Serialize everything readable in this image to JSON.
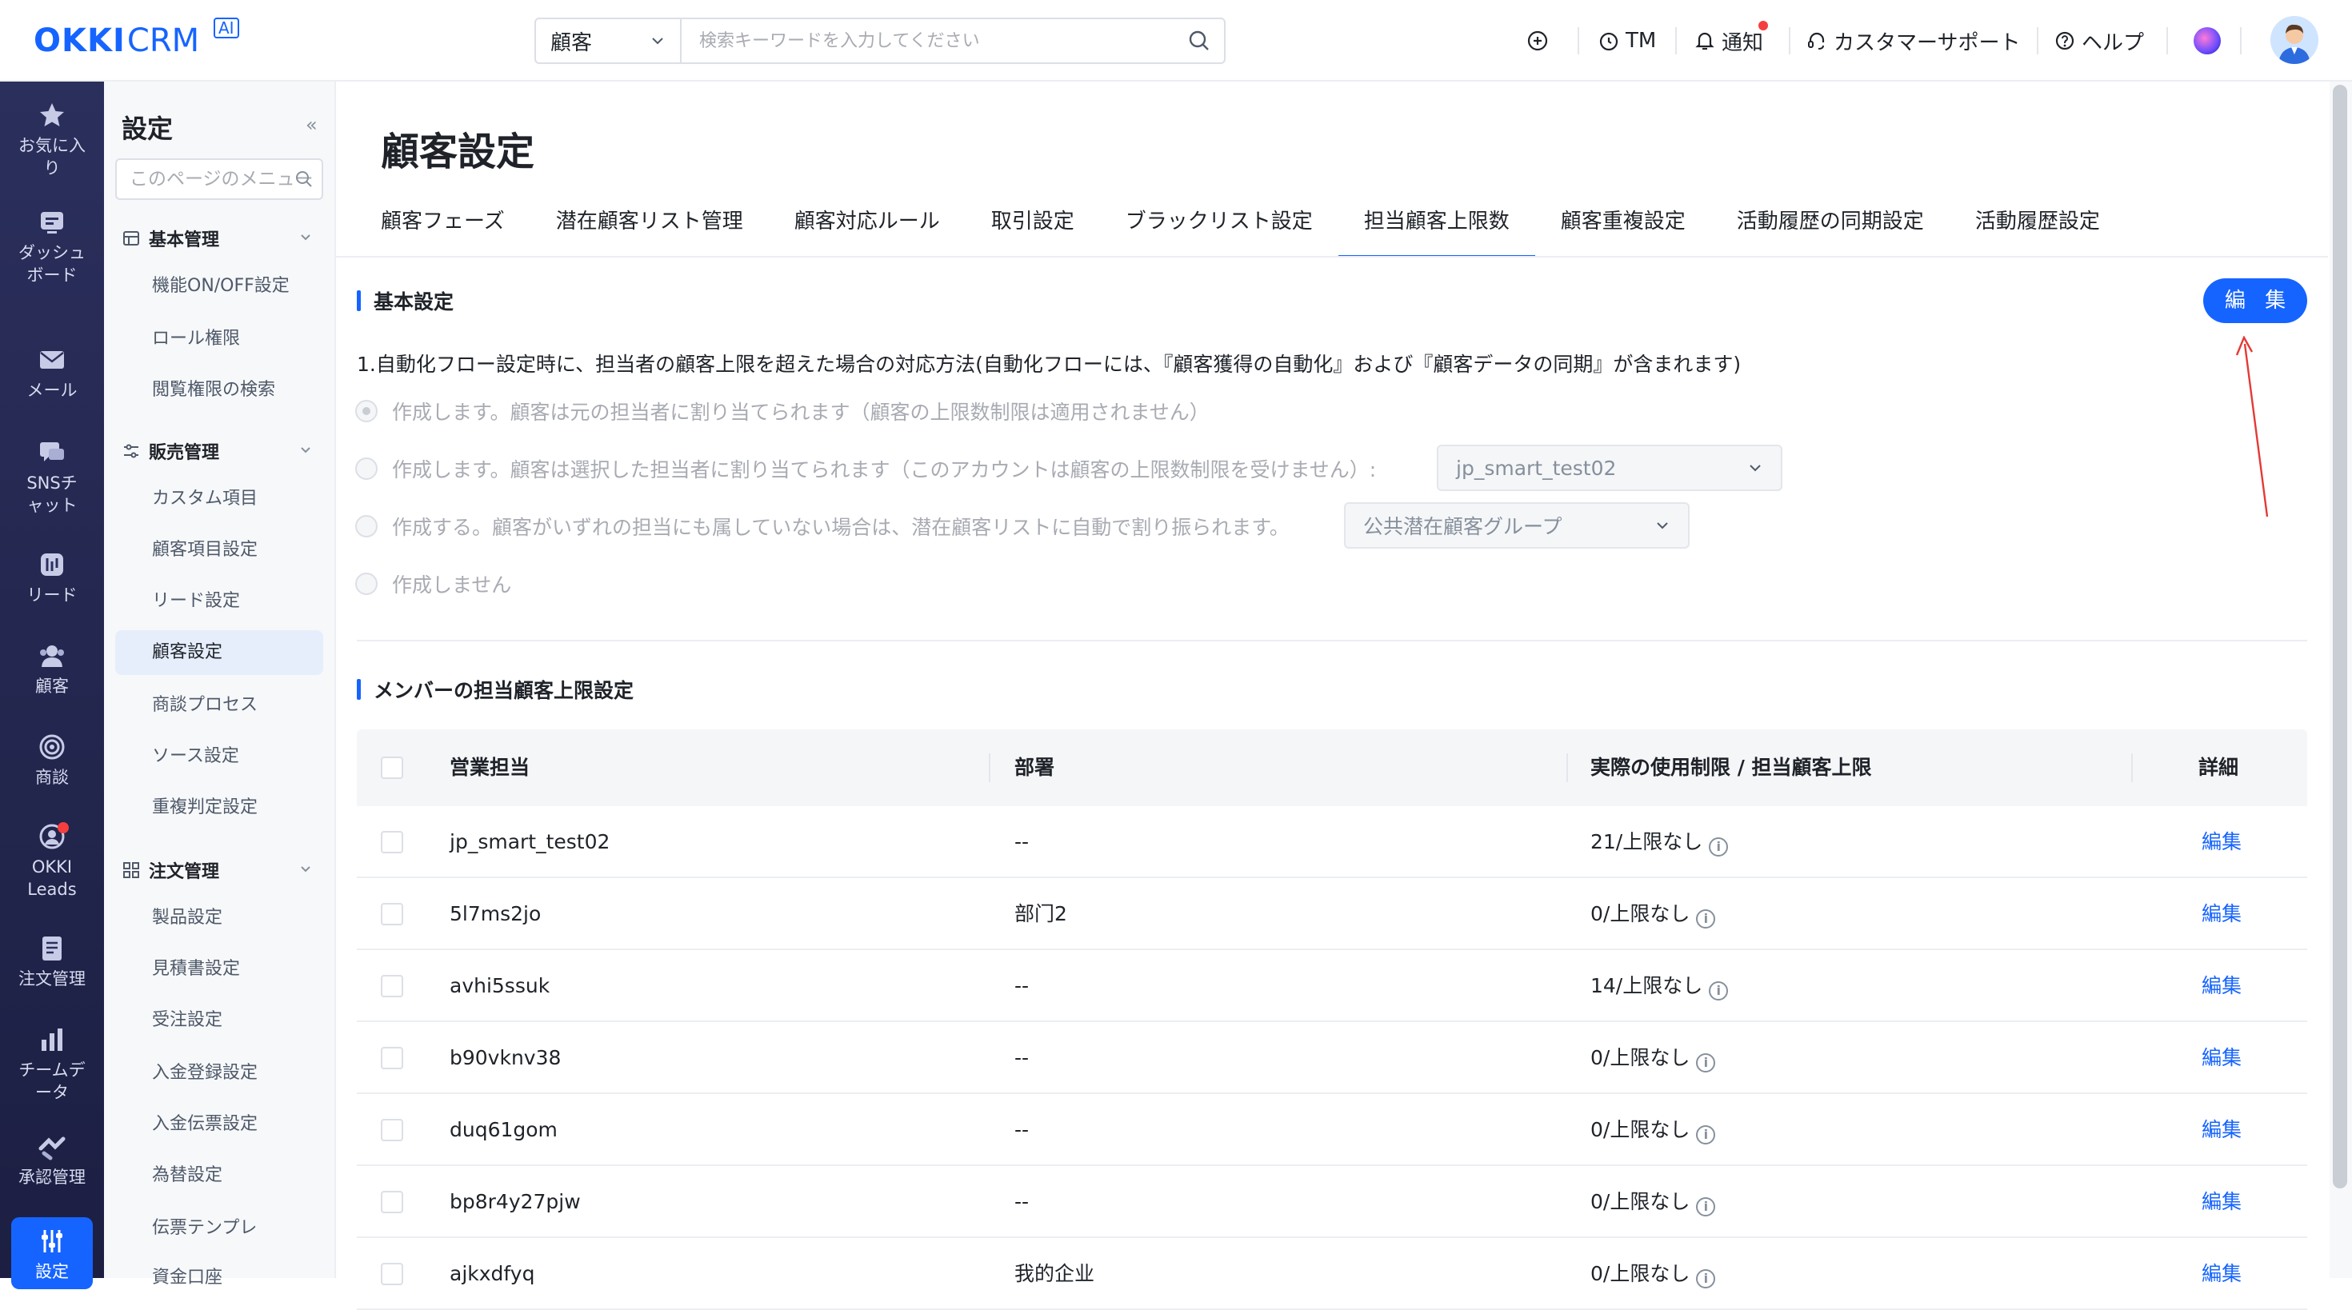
{
  "brand": {
    "logo_main": "OKKI",
    "logo_sub": "CRM",
    "logo_badge": "AI",
    "accent": "#1664ff"
  },
  "search": {
    "scope": "顧客",
    "placeholder": "検索キーワードを入力してください"
  },
  "topbar": {
    "tm": "TM",
    "notify": "通知",
    "support": "カスタマーサポート",
    "help": "ヘルプ"
  },
  "leftnav": [
    {
      "label": "お気に入り",
      "icon": "star-icon"
    },
    {
      "label": "ダッシュボード",
      "icon": "dashboard-icon"
    },
    {
      "label": "メール",
      "icon": "mail-icon"
    },
    {
      "label": "SNSチャット",
      "icon": "chat-icon"
    },
    {
      "label": "リード",
      "icon": "lead-icon"
    },
    {
      "label": "顧客",
      "icon": "customer-icon"
    },
    {
      "label": "商談",
      "icon": "target-icon"
    },
    {
      "label": "OKKI Leads",
      "icon": "okki-leads-icon"
    },
    {
      "label": "注文管理",
      "icon": "order-icon"
    },
    {
      "label": "チームデータ",
      "icon": "chart-icon"
    },
    {
      "label": "承認管理",
      "icon": "approval-icon"
    },
    {
      "label": "設定",
      "icon": "settings-icon"
    }
  ],
  "settings": {
    "title": "設定",
    "search_placeholder": "このページのメニュー",
    "groups": [
      {
        "label": "基本管理",
        "items": [
          "機能ON/OFF設定",
          "ロール権限",
          "閲覧権限の検索"
        ]
      },
      {
        "label": "販売管理",
        "items": [
          "カスタム項目",
          "顧客項目設定",
          "リード設定",
          "顧客設定",
          "商談プロセス",
          "ソース設定",
          "重複判定設定"
        ]
      },
      {
        "label": "注文管理",
        "items": [
          "製品設定",
          "見積書設定",
          "受注設定",
          "入金登録設定",
          "入金伝票設定",
          "為替設定",
          "伝票テンプレ",
          "資金口座"
        ]
      }
    ],
    "active_item": "顧客設定"
  },
  "page": {
    "title": "顧客設定",
    "tabs": [
      "顧客フェーズ",
      "潜在顧客リスト管理",
      "顧客対応ルール",
      "取引設定",
      "ブラックリスト設定",
      "担当顧客上限数",
      "顧客重複設定",
      "活動履歴の同期設定",
      "活動履歴設定"
    ],
    "active_tab": "担当顧客上限数",
    "edit_button": "編 集"
  },
  "basic": {
    "heading": "基本設定",
    "question": "1.自動化フロー設定時に、担当者の顧客上限を超えた場合の対応方法(自動化フローには、『顧客獲得の自動化』および『顧客データの同期』が含まれます)",
    "options": [
      "作成します。顧客は元の担当者に割り当てられます（顧客の上限数制限は適用されません）",
      "作成します。顧客は選択した担当者に割り当てられます（このアカウントは顧客の上限数制限を受けません）:",
      "作成する。顧客がいずれの担当にも属していない場合は、潜在顧客リストに自動で割り振られます。",
      "作成しません"
    ],
    "selected_option": 0,
    "owner_select": "jp_smart_test02",
    "pool_select": "公共潜在顧客グループ"
  },
  "members": {
    "heading": "メンバーの担当顧客上限設定",
    "columns": [
      "営業担当",
      "部署",
      "実際の使用制限 / 担当顧客上限",
      "詳細"
    ],
    "rows": [
      {
        "name": "jp_smart_test02",
        "dept": "--",
        "limit": "21/上限なし",
        "action": "編集"
      },
      {
        "name": "5l7ms2jo",
        "dept": "部门2",
        "limit": "0/上限なし",
        "action": "編集"
      },
      {
        "name": "avhi5ssuk",
        "dept": "--",
        "limit": "14/上限なし",
        "action": "編集"
      },
      {
        "name": "b90vknv38",
        "dept": "--",
        "limit": "0/上限なし",
        "action": "編集"
      },
      {
        "name": "duq61gom",
        "dept": "--",
        "limit": "0/上限なし",
        "action": "編集"
      },
      {
        "name": "bp8r4y27pjw",
        "dept": "--",
        "limit": "0/上限なし",
        "action": "編集"
      },
      {
        "name": "ajkxdfyq",
        "dept": "我的企业",
        "limit": "0/上限なし",
        "action": "編集"
      }
    ]
  }
}
